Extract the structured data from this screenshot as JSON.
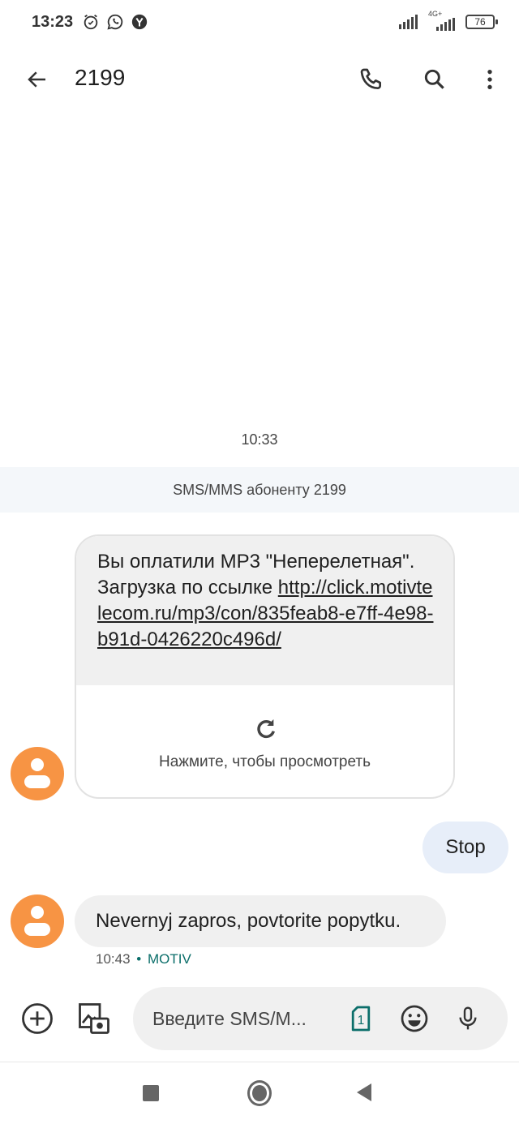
{
  "status_bar": {
    "time": "13:23",
    "left_icons": [
      "alarm-icon",
      "whatsapp-icon",
      "yandex-icon"
    ],
    "network_label": "4G+",
    "battery": "76"
  },
  "app_bar": {
    "title": "2199",
    "back_icon": "arrow-left-icon",
    "actions": [
      "phone-icon",
      "search-icon",
      "more-vert-icon"
    ]
  },
  "conversation": {
    "timestamp": "10:33",
    "info_banner": "SMS/MMS абоненту 2199",
    "messages": [
      {
        "direction": "incoming",
        "type": "mms",
        "text_prefix": "Вы оплатили MP3 \"Неперелетная\". Загрузка по ссылке ",
        "link": "http://click.motivtelecom.ru/mp3/con/835feab8-e7ff-4e98-b91d-0426220c496d/",
        "download_hint": "Нажмите, чтобы просмотреть",
        "download_icon": "refresh-icon"
      },
      {
        "direction": "outgoing",
        "type": "sms",
        "text": "Stop"
      },
      {
        "direction": "incoming",
        "type": "sms",
        "text": "Nevernyj zapros, povtorite popytku.",
        "time": "10:43",
        "separator": "•",
        "sender": "MOTIV"
      }
    ]
  },
  "compose": {
    "placeholder": "Введите SMS/M...",
    "sim_label": "1",
    "icons": [
      "add-circle-icon",
      "gallery-camera-icon",
      "sim-card-icon",
      "emoji-icon",
      "mic-icon"
    ]
  },
  "colors": {
    "avatar": "#f79444",
    "incoming_bubble": "#f0f0f0",
    "outgoing_bubble": "#e7eef9",
    "accent_teal": "#0b6e6a",
    "banner_bg": "#f4f7fa"
  },
  "nav_bar": {
    "buttons": [
      "recents-button",
      "home-button",
      "back-button"
    ]
  }
}
